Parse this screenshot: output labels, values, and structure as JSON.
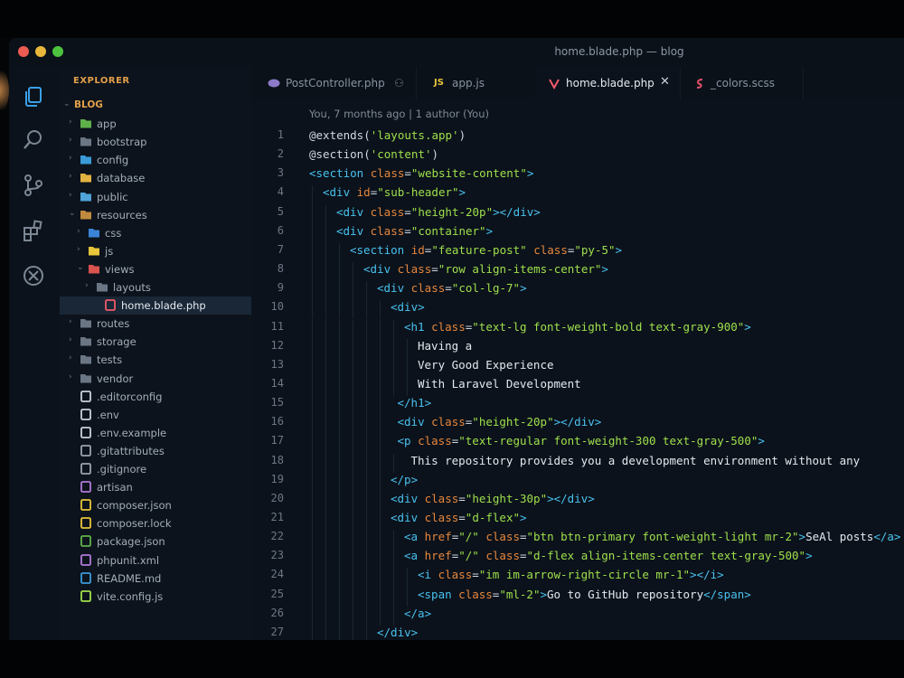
{
  "window": {
    "title": "home.blade.php — blog"
  },
  "explorer": {
    "title": "EXPLORER",
    "root": "BLOG",
    "items": [
      {
        "label": "app",
        "type": "folder",
        "depth": 1,
        "color": "#5fb24a"
      },
      {
        "label": "bootstrap",
        "type": "folder",
        "depth": 1,
        "color": "#6b7685"
      },
      {
        "label": "config",
        "type": "folder",
        "depth": 1,
        "color": "#3a9bd8"
      },
      {
        "label": "database",
        "type": "folder",
        "depth": 1,
        "color": "#e3b341"
      },
      {
        "label": "public",
        "type": "folder",
        "depth": 1,
        "color": "#4fa3d9"
      },
      {
        "label": "resources",
        "type": "folder-open",
        "depth": 1,
        "color": "#c08b3e"
      },
      {
        "label": "css",
        "type": "folder",
        "depth": 2,
        "color": "#3a84d8"
      },
      {
        "label": "js",
        "type": "folder",
        "depth": 2,
        "color": "#e8c53a"
      },
      {
        "label": "views",
        "type": "folder-open",
        "depth": 2,
        "color": "#d9534f"
      },
      {
        "label": "layouts",
        "type": "folder",
        "depth": 3,
        "color": "#6b7685"
      },
      {
        "label": "home.blade.php",
        "type": "file",
        "depth": 4,
        "color": "#f05a6a",
        "selected": true
      },
      {
        "label": "routes",
        "type": "folder",
        "depth": 1,
        "color": "#6b7685"
      },
      {
        "label": "storage",
        "type": "folder",
        "depth": 1,
        "color": "#6b7685"
      },
      {
        "label": "tests",
        "type": "folder",
        "depth": 1,
        "color": "#6b7685"
      },
      {
        "label": "vendor",
        "type": "folder",
        "depth": 1,
        "color": "#6b7685"
      },
      {
        "label": ".editorconfig",
        "type": "file",
        "depth": 1,
        "color": "#c9d1db"
      },
      {
        "label": ".env",
        "type": "file",
        "depth": 1,
        "color": "#c9d1db"
      },
      {
        "label": ".env.example",
        "type": "file",
        "depth": 1,
        "color": "#c9d1db"
      },
      {
        "label": ".gitattributes",
        "type": "file",
        "depth": 1,
        "color": "#9aa4b0"
      },
      {
        "label": ".gitignore",
        "type": "file",
        "depth": 1,
        "color": "#9aa4b0"
      },
      {
        "label": "artisan",
        "type": "file",
        "depth": 1,
        "color": "#b07ad9"
      },
      {
        "label": "composer.json",
        "type": "file",
        "depth": 1,
        "color": "#e8c53a"
      },
      {
        "label": "composer.lock",
        "type": "file",
        "depth": 1,
        "color": "#e8c53a"
      },
      {
        "label": "package.json",
        "type": "file",
        "depth": 1,
        "color": "#5fb24a"
      },
      {
        "label": "phpunit.xml",
        "type": "file",
        "depth": 1,
        "color": "#b07ad9"
      },
      {
        "label": "README.md",
        "type": "file",
        "depth": 1,
        "color": "#3a9bd8"
      },
      {
        "label": "vite.config.js",
        "type": "file",
        "depth": 1,
        "color": "#9fe04c"
      }
    ]
  },
  "tabs": [
    {
      "label": "PostController.php",
      "icon": "php-icon",
      "badge": "⚇"
    },
    {
      "label": "app.js",
      "icon": "js-icon",
      "prefix": "JS"
    },
    {
      "label": "home.blade.php",
      "icon": "blade-icon",
      "active": true,
      "close": "✕"
    },
    {
      "label": "_colors.scss",
      "icon": "scss-icon"
    }
  ],
  "editor": {
    "blame": "You, 7 months ago | 1 author (You)",
    "lines": [
      {
        "n": "1",
        "indent": 0,
        "tokens": [
          [
            "dir",
            "@extends("
          ],
          [
            "str",
            "'layouts.app'"
          ],
          [
            "dir",
            ")"
          ]
        ]
      },
      {
        "n": "2",
        "indent": 0,
        "tokens": [
          [
            "dir",
            "@section("
          ],
          [
            "str",
            "'content'"
          ],
          [
            "dir",
            ")"
          ]
        ]
      },
      {
        "n": "3",
        "indent": 0,
        "tokens": [
          [
            "tag",
            "<section"
          ],
          [
            "attr",
            " class"
          ],
          [
            "punc",
            "="
          ],
          [
            "str",
            "\"website-content\""
          ],
          [
            "tag",
            ">"
          ]
        ]
      },
      {
        "n": "4",
        "indent": 1,
        "tokens": [
          [
            "tag",
            "<div"
          ],
          [
            "attr",
            " id"
          ],
          [
            "punc",
            "="
          ],
          [
            "str",
            "\"sub-header\""
          ],
          [
            "tag",
            ">"
          ]
        ]
      },
      {
        "n": "5",
        "indent": 2,
        "tokens": [
          [
            "tag",
            "<div"
          ],
          [
            "attr",
            " class"
          ],
          [
            "punc",
            "="
          ],
          [
            "str",
            "\"height-20p\""
          ],
          [
            "tag",
            "></div>"
          ]
        ]
      },
      {
        "n": "6",
        "indent": 2,
        "tokens": [
          [
            "tag",
            "<div"
          ],
          [
            "attr",
            " class"
          ],
          [
            "punc",
            "="
          ],
          [
            "str",
            "\"container\""
          ],
          [
            "tag",
            ">"
          ]
        ]
      },
      {
        "n": "7",
        "indent": 3,
        "tokens": [
          [
            "tag",
            "<section"
          ],
          [
            "attr",
            " id"
          ],
          [
            "punc",
            "="
          ],
          [
            "str",
            "\"feature-post\""
          ],
          [
            "attr",
            " class"
          ],
          [
            "punc",
            "="
          ],
          [
            "str",
            "\"py-5\""
          ],
          [
            "tag",
            ">"
          ]
        ]
      },
      {
        "n": "8",
        "indent": 4,
        "tokens": [
          [
            "tag",
            "<div"
          ],
          [
            "attr",
            " class"
          ],
          [
            "punc",
            "="
          ],
          [
            "str",
            "\"row align-items-center\""
          ],
          [
            "tag",
            ">"
          ]
        ]
      },
      {
        "n": "9",
        "indent": 5,
        "tokens": [
          [
            "tag",
            "<div"
          ],
          [
            "attr",
            " class"
          ],
          [
            "punc",
            "="
          ],
          [
            "str",
            "\"col-lg-7\""
          ],
          [
            "tag",
            ">"
          ]
        ]
      },
      {
        "n": "10",
        "indent": 6,
        "tokens": [
          [
            "tag",
            "<div>"
          ]
        ]
      },
      {
        "n": "11",
        "indent": 7,
        "tokens": [
          [
            "tag",
            "<h1"
          ],
          [
            "attr",
            " class"
          ],
          [
            "punc",
            "="
          ],
          [
            "str",
            "\"text-lg font-weight-bold text-gray-900\""
          ],
          [
            "tag",
            ">"
          ]
        ]
      },
      {
        "n": "12",
        "indent": 8,
        "tokens": [
          [
            "text",
            "Having a"
          ]
        ]
      },
      {
        "n": "13",
        "indent": 8,
        "tokens": [
          [
            "text",
            "Very Good Experience"
          ]
        ]
      },
      {
        "n": "14",
        "indent": 8,
        "tokens": [
          [
            "text",
            "With Laravel Development"
          ]
        ]
      },
      {
        "n": "15",
        "indent": 6.5,
        "tokens": [
          [
            "tag",
            "</h1>"
          ]
        ]
      },
      {
        "n": "16",
        "indent": 6.5,
        "tokens": [
          [
            "tag",
            "<div"
          ],
          [
            "attr",
            " class"
          ],
          [
            "punc",
            "="
          ],
          [
            "str",
            "\"height-20p\""
          ],
          [
            "tag",
            "></div>"
          ]
        ]
      },
      {
        "n": "17",
        "indent": 6.5,
        "tokens": [
          [
            "tag",
            "<p"
          ],
          [
            "attr",
            " class"
          ],
          [
            "punc",
            "="
          ],
          [
            "str",
            "\"text-regular font-weight-300 text-gray-500\""
          ],
          [
            "tag",
            ">"
          ]
        ]
      },
      {
        "n": "18",
        "indent": 7.5,
        "tokens": [
          [
            "text",
            "This repository provides you a development environment without any"
          ]
        ]
      },
      {
        "n": "19",
        "indent": 6,
        "tokens": [
          [
            "tag",
            "</p>"
          ]
        ]
      },
      {
        "n": "20",
        "indent": 6,
        "tokens": [
          [
            "tag",
            "<div"
          ],
          [
            "attr",
            " class"
          ],
          [
            "punc",
            "="
          ],
          [
            "str",
            "\"height-30p\""
          ],
          [
            "tag",
            "></div>"
          ]
        ]
      },
      {
        "n": "21",
        "indent": 6,
        "tokens": [
          [
            "tag",
            "<div"
          ],
          [
            "attr",
            " class"
          ],
          [
            "punc",
            "="
          ],
          [
            "str",
            "\"d-flex\""
          ],
          [
            "tag",
            ">"
          ]
        ]
      },
      {
        "n": "22",
        "indent": 7,
        "tokens": [
          [
            "tag",
            "<a"
          ],
          [
            "attr",
            " href"
          ],
          [
            "punc",
            "="
          ],
          [
            "str",
            "\"/\""
          ],
          [
            "attr",
            " class"
          ],
          [
            "punc",
            "="
          ],
          [
            "str",
            "\"btn btn-primary font-weight-light mr-2\""
          ],
          [
            "tag",
            ">"
          ],
          [
            "text",
            "SeAl posts"
          ],
          [
            "tag",
            "</a>"
          ]
        ]
      },
      {
        "n": "23",
        "indent": 7,
        "tokens": [
          [
            "tag",
            "<a"
          ],
          [
            "attr",
            " href"
          ],
          [
            "punc",
            "="
          ],
          [
            "str",
            "\"/\""
          ],
          [
            "attr",
            " class"
          ],
          [
            "punc",
            "="
          ],
          [
            "str",
            "\"d-flex align-items-center text-gray-500\""
          ],
          [
            "tag",
            ">"
          ]
        ]
      },
      {
        "n": "24",
        "indent": 8,
        "tokens": [
          [
            "tag",
            "<i"
          ],
          [
            "attr",
            " class"
          ],
          [
            "punc",
            "="
          ],
          [
            "str",
            "\"im im-arrow-right-circle mr-1\""
          ],
          [
            "tag",
            "></i>"
          ]
        ]
      },
      {
        "n": "25",
        "indent": 8,
        "tokens": [
          [
            "tag",
            "<span"
          ],
          [
            "attr",
            " class"
          ],
          [
            "punc",
            "="
          ],
          [
            "str",
            "\"ml-2\""
          ],
          [
            "tag",
            ">"
          ],
          [
            "text",
            "Go to GitHub repository"
          ],
          [
            "tag",
            "</span>"
          ]
        ]
      },
      {
        "n": "26",
        "indent": 7,
        "tokens": [
          [
            "tag",
            "</a>"
          ]
        ]
      },
      {
        "n": "27",
        "indent": 5,
        "tokens": [
          [
            "tag",
            "</div>"
          ]
        ]
      }
    ]
  },
  "activity_bar": [
    "explorer-icon",
    "search-icon",
    "source-control-icon",
    "extensions-icon",
    "remote-icon"
  ]
}
